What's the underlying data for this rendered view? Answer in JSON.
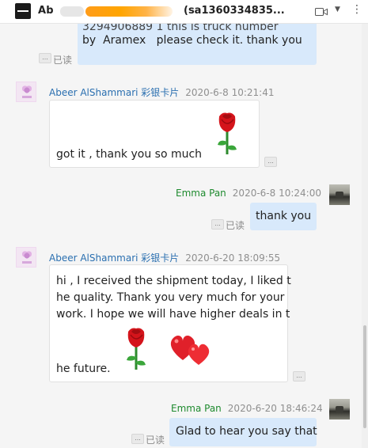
{
  "header": {
    "title_prefix": "Ab",
    "title_suffix": "(sa1360334835...",
    "video_icon": "video-call-icon",
    "caret_icon": "chevron-down-icon",
    "more_icon": "more-icon"
  },
  "colors": {
    "blue_bubble": "#d8e9fb",
    "white_bubble": "#ffffff",
    "name_blue": "#2a6fb0",
    "name_green": "#1e8a2e"
  },
  "messages": [
    {
      "sender": "",
      "time": "",
      "text_line1": "3294906889 1 this is truck number",
      "text_line2": "by  Aramex   please check it. thank you",
      "read": "已读"
    },
    {
      "sender": "Abeer AlShammari 彩银卡片",
      "time": "2020-6-8 10:21:41",
      "text": "got it , thank you so much",
      "emoji": "rose-emoji"
    },
    {
      "sender": "Emma Pan",
      "time": "2020-6-8 10:24:00",
      "text": "thank you",
      "read": "已读"
    },
    {
      "sender": "Abeer AlShammari 彩银卡片",
      "time": "2020-6-20 18:09:55",
      "lines": [
        "hi , I received the shipment today, I liked t",
        "he quality. Thank you very much for your",
        "work. I hope we will have higher deals in t",
        "he future."
      ],
      "emoji": [
        "rose-emoji",
        "hearts-emoji"
      ]
    },
    {
      "sender": "Emma Pan",
      "time": "2020-6-20 18:46:24",
      "text": "Glad to hear you say that",
      "read": "已读"
    }
  ],
  "more_btn": "..."
}
